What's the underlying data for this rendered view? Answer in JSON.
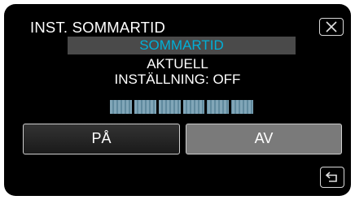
{
  "header": {
    "title": "INST. SOMMARTID",
    "close_icon": "close-icon"
  },
  "banner": {
    "label": "SOMMARTID",
    "color": "#00b0d8"
  },
  "status": {
    "line1": "AKTUELL",
    "line2": "INSTÄLLNING: OFF"
  },
  "options": {
    "on_label": "PÅ",
    "off_label": "AV"
  },
  "footer": {
    "back_icon": "return-icon"
  }
}
